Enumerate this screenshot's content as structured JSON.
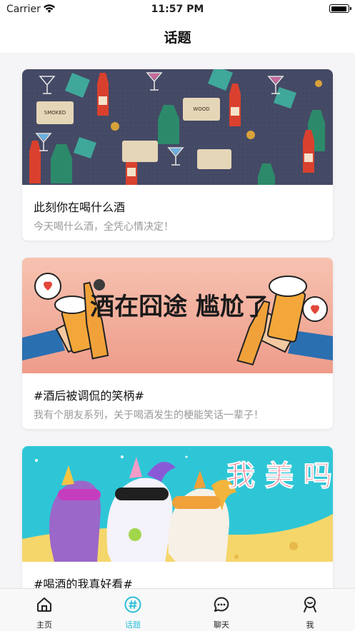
{
  "status_bar": {
    "carrier": "Carrier",
    "time": "11:57 PM"
  },
  "nav": {
    "title": "话题"
  },
  "cards": [
    {
      "title": "此刻你在喝什么酒",
      "subtitle": "今天喝什么酒，全凭心情决定！",
      "image": "drinks-pattern",
      "badges": [
        "SMOKED",
        "WOOD"
      ]
    },
    {
      "title": "#酒后被调侃的笑柄#",
      "subtitle": "我有个朋友系列，关于喝酒发生的梗能笑话一辈子！",
      "image": "beer-cheers",
      "banner_text": "酒在囧途 尴尬了"
    },
    {
      "title": "#喝酒的我真好看#",
      "subtitle": "",
      "image": "unicorns",
      "banner_text": "我 美 吗"
    }
  ],
  "tabbar": {
    "items": [
      {
        "label": "主页",
        "icon": "home-icon",
        "active": false
      },
      {
        "label": "话题",
        "icon": "hashtag-icon",
        "active": true
      },
      {
        "label": "聊天",
        "icon": "chat-icon",
        "active": false
      },
      {
        "label": "我",
        "icon": "profile-icon",
        "active": false
      }
    ]
  },
  "colors": {
    "accent": "#2bbfd8",
    "card1_bg": "#454a66",
    "card2_bg": "#f2a896",
    "card3_bg": "#2ec6d6"
  }
}
